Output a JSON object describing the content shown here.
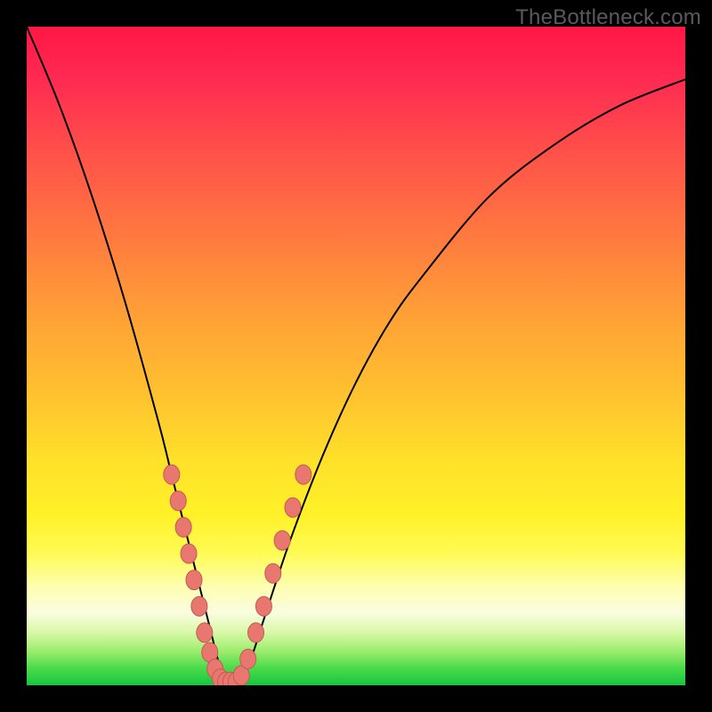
{
  "watermark": "TheBottleneck.com",
  "chart_data": {
    "type": "line",
    "title": "",
    "xlabel": "",
    "ylabel": "",
    "xlim": [
      0,
      100
    ],
    "ylim": [
      0,
      100
    ],
    "grid": false,
    "legend": false,
    "series": [
      {
        "name": "bottleneck-curve",
        "x": [
          0,
          5,
          10,
          15,
          20,
          22,
          24,
          26,
          28,
          29,
          30,
          31,
          32,
          34,
          36,
          40,
          45,
          50,
          55,
          60,
          70,
          80,
          90,
          100
        ],
        "y": [
          100,
          88,
          74,
          58,
          40,
          32,
          24,
          16,
          8,
          4,
          1,
          0.5,
          1,
          4,
          10,
          22,
          35,
          46,
          55,
          62,
          74,
          82,
          88,
          92
        ]
      }
    ],
    "markers": {
      "name": "highlighted-points",
      "color": "#e8776f",
      "points": [
        {
          "x": 22.0,
          "y": 32
        },
        {
          "x": 23.0,
          "y": 28
        },
        {
          "x": 23.8,
          "y": 24
        },
        {
          "x": 24.6,
          "y": 20
        },
        {
          "x": 25.4,
          "y": 16
        },
        {
          "x": 26.2,
          "y": 12
        },
        {
          "x": 27.0,
          "y": 8
        },
        {
          "x": 27.8,
          "y": 5
        },
        {
          "x": 28.6,
          "y": 2.5
        },
        {
          "x": 29.4,
          "y": 1
        },
        {
          "x": 30.2,
          "y": 0.5
        },
        {
          "x": 31.0,
          "y": 0.5
        },
        {
          "x": 31.8,
          "y": 0.5
        },
        {
          "x": 32.6,
          "y": 1.5
        },
        {
          "x": 33.6,
          "y": 4
        },
        {
          "x": 34.8,
          "y": 8
        },
        {
          "x": 36.0,
          "y": 12
        },
        {
          "x": 37.4,
          "y": 17
        },
        {
          "x": 38.8,
          "y": 22
        },
        {
          "x": 40.4,
          "y": 27
        },
        {
          "x": 42.0,
          "y": 32
        }
      ]
    },
    "background_gradient": {
      "type": "vertical",
      "stops": [
        {
          "pos": 0.0,
          "color": "#ff1744"
        },
        {
          "pos": 0.45,
          "color": "#ffa136"
        },
        {
          "pos": 0.7,
          "color": "#ffe12a"
        },
        {
          "pos": 0.88,
          "color": "#fafde0"
        },
        {
          "pos": 1.0,
          "color": "#17c63e"
        }
      ]
    }
  }
}
